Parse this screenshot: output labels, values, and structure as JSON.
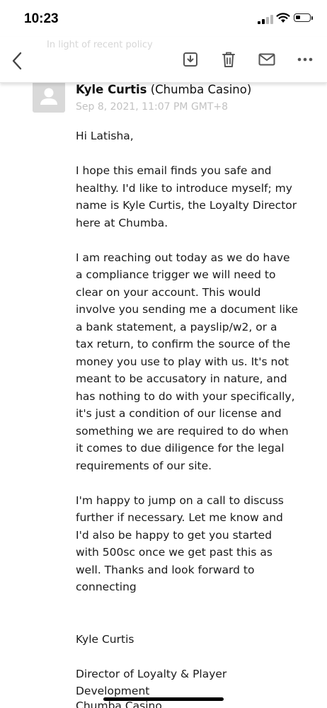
{
  "status_bar": {
    "time": "10:23"
  },
  "toolbar": {
    "back_icon": "chevron-left-icon",
    "archive_icon": "archive-icon",
    "delete_icon": "trash-icon",
    "mark_unread_icon": "envelope-icon",
    "more_icon": "ellipsis-icon",
    "faded_subject": "In light of recent policy"
  },
  "message": {
    "sender_name": "Kyle Curtis",
    "sender_org": "(Chumba Casino)",
    "date": "Sep 8, 2021, 11:07 PM GMT+8",
    "greeting": "Hi Latisha,",
    "paragraph_1": "I hope this email finds you safe and\nhealthy. I'd like to introduce myself; my\nname is Kyle Curtis, the Loyalty Director\nhere at Chumba.",
    "paragraph_2": "I am reaching out today as we do have\na compliance trigger we will need to\nclear on your account. This would\ninvolve you sending me a document like\na bank statement, a payslip/w2, or a\ntax return, to confirm the source of the\nmoney you use to play with us. It's not\nmeant to be accusatory in nature, and\nhas nothing to do with your specifically,\nit's just a condition of our license and\nsomething we are required to do when\nit comes to due diligence for the legal\nrequirements of our site.",
    "paragraph_3": "I'm happy to jump on a call to discuss\nfurther if necessary. Let me know and\nI'd also be happy to get you started\nwith 500sc once we get past this as\nwell. Thanks and look forward to\nconnecting",
    "signature_name": "Kyle Curtis",
    "signature_title": "Director of Loyalty & Player\nDevelopment",
    "signature_company_cutoff": "Chumba Casino"
  },
  "colors": {
    "date_text": "#c2c2c2",
    "icon": "#555555",
    "avatar_bg": "#d9d9d9"
  }
}
